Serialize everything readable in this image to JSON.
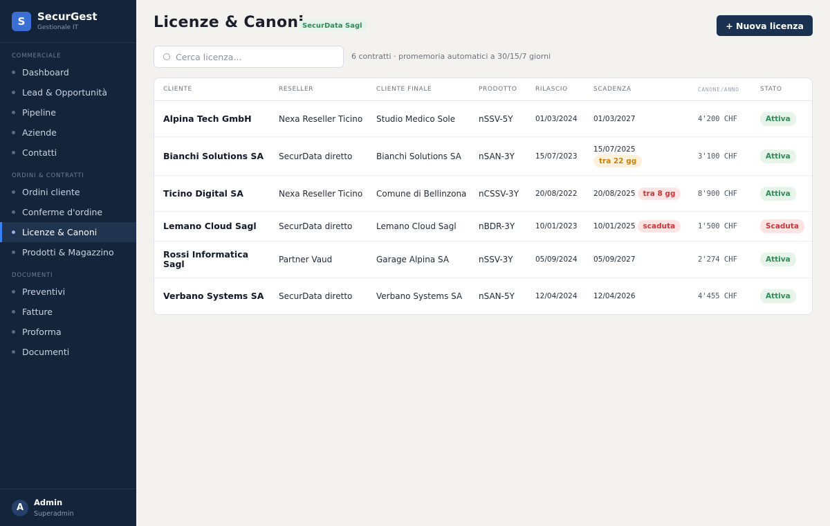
{
  "app": {
    "name": "SecurGest",
    "subtitle": "Gestionale IT",
    "logo_letter": "S"
  },
  "sidebar": {
    "sections": [
      {
        "title": "COMMERCIALE",
        "items": [
          "Dashboard",
          "Lead & Opportunità",
          "Pipeline",
          "Aziende",
          "Contatti"
        ]
      },
      {
        "title": "ORDINI & CONTRATTI",
        "items": [
          "Ordini cliente",
          "Conferme d'ordine",
          "Licenze & Canoni",
          "Prodotti & Magazzino"
        ]
      },
      {
        "title": "DOCUMENTI",
        "items": [
          "Preventivi",
          "Fatture",
          "Proforma",
          "Documenti"
        ]
      }
    ],
    "active_item": "Licenze & Canoni"
  },
  "user": {
    "initial": "A",
    "name": "Admin",
    "role": "Superadmin"
  },
  "header": {
    "title": "Licenze & Canoni",
    "company_badge": "SecurData Sagl",
    "new_button": "+ Nuova licenza"
  },
  "search": {
    "placeholder": "Cerca licenza..."
  },
  "summary": "6 contratti · promemoria automatici a 30/15/7 giorni",
  "table": {
    "columns": [
      "CLIENTE",
      "RESELLER",
      "CLIENTE FINALE",
      "PRODOTTO",
      "RILASCIO",
      "SCADENZA",
      "CANONE/ANNO",
      "STATO"
    ],
    "rows": [
      {
        "cliente": "Alpina Tech GmbH",
        "reseller": "Nexa Reseller Ticino",
        "finale": "Studio Medico Sole",
        "prodotto": "nSSV-5Y",
        "rilascio": "01/03/2024",
        "scadenza": "01/03/2027",
        "tag": "",
        "tag_type": "",
        "canone": "4'200 CHF",
        "stato": "Attiva",
        "stato_type": "ok"
      },
      {
        "cliente": "Bianchi Solutions SA",
        "reseller": "SecurData diretto",
        "finale": "Bianchi Solutions SA",
        "prodotto": "nSAN-3Y",
        "rilascio": "15/07/2023",
        "scadenza": "15/07/2025",
        "tag": "tra 22 gg",
        "tag_type": "warn",
        "canone": "3'100 CHF",
        "stato": "Attiva",
        "stato_type": "ok"
      },
      {
        "cliente": "Ticino Digital SA",
        "reseller": "Nexa Reseller Ticino",
        "finale": "Comune di Bellinzona",
        "prodotto": "nCSSV-3Y",
        "rilascio": "20/08/2022",
        "scadenza": "20/08/2025",
        "tag": "tra 8 gg",
        "tag_type": "alert",
        "canone": "8'900 CHF",
        "stato": "Attiva",
        "stato_type": "ok"
      },
      {
        "cliente": "Lemano Cloud Sagl",
        "reseller": "SecurData diretto",
        "finale": "Lemano Cloud Sagl",
        "prodotto": "nBDR-3Y",
        "rilascio": "10/01/2023",
        "scadenza": "10/01/2025",
        "tag": "scaduta",
        "tag_type": "alert",
        "canone": "1'500 CHF",
        "stato": "Scaduta",
        "stato_type": "bad"
      },
      {
        "cliente": "Rossi Informatica Sagl",
        "reseller": "Partner Vaud",
        "finale": "Garage Alpina SA",
        "prodotto": "nSSV-3Y",
        "rilascio": "05/09/2024",
        "scadenza": "05/09/2027",
        "tag": "",
        "tag_type": "",
        "canone": "2'274 CHF",
        "stato": "Attiva",
        "stato_type": "ok"
      },
      {
        "cliente": "Verbano Systems SA",
        "reseller": "SecurData diretto",
        "finale": "Verbano Systems SA",
        "prodotto": "nSAN-5Y",
        "rilascio": "12/04/2024",
        "scadenza": "12/04/2026",
        "tag": "",
        "tag_type": "",
        "canone": "4'455 CHF",
        "stato": "Attiva",
        "stato_type": "ok"
      }
    ]
  }
}
